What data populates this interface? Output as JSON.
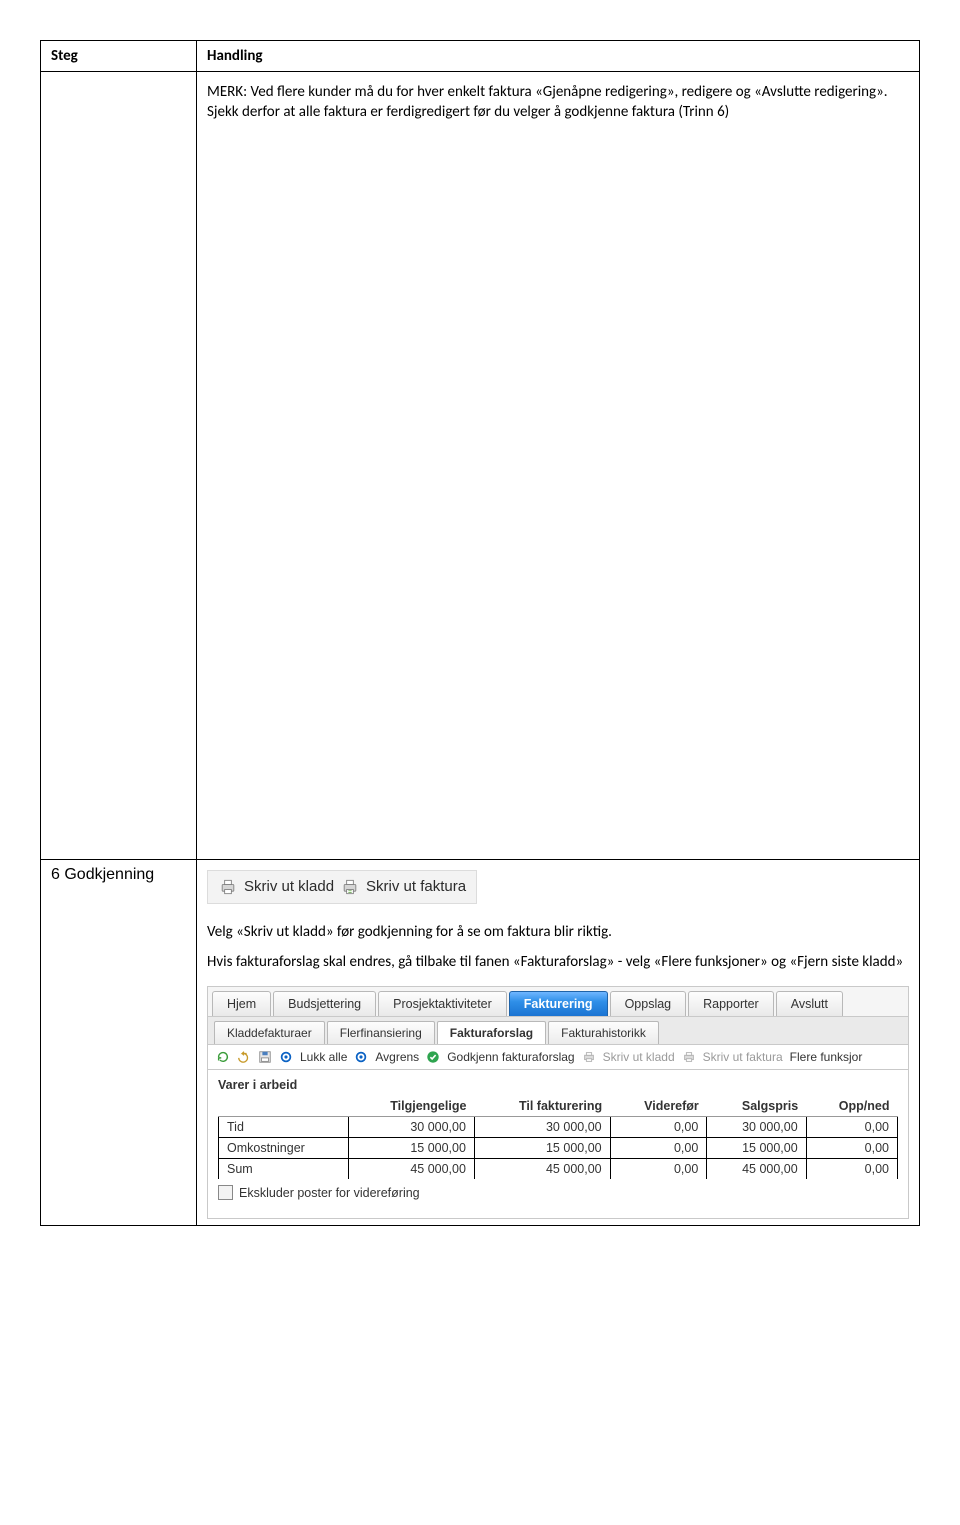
{
  "headers": {
    "steg": "Steg",
    "handling": "Handling"
  },
  "row1": {
    "p1a": "MERK: Ved flere kunder må du for hver enkelt faktura «Gjenåpne redigering», redigere og «Avslutte redigering». Sjekk derfor at alle faktura er ferdigredigert før du velger å godkjenne faktura (Trinn 6)"
  },
  "row2": {
    "step_label": "6 Godkjenning",
    "print": {
      "kladd": "Skriv ut kladd",
      "faktura": "Skriv ut faktura"
    },
    "p1": "Velg «Skriv ut kladd» før godkjenning for å se om faktura blir riktig.",
    "p2": "Hvis fakturaforslag skal endres, gå tilbake til fanen «Fakturaforslag» - velg «Flere funksjoner» og «Fjern siste kladd»",
    "tabs1": [
      "Hjem",
      "Budsjettering",
      "Prosjektaktiviteter",
      "Fakturering",
      "Oppslag",
      "Rapporter",
      "Avslutt"
    ],
    "tabs1_active_index": 3,
    "tabs2": [
      "Kladdefakturaer",
      "Flerfinansiering",
      "Fakturaforslag",
      "Fakturahistorikk"
    ],
    "tabs2_active_index": 2,
    "toolbar": {
      "lukk_alle": "Lukk alle",
      "avgrens": "Avgrens",
      "godkjenn": "Godkjenn fakturaforslag",
      "skriv_kladd": "Skriv ut kladd",
      "skriv_faktura": "Skriv ut faktura",
      "flere": "Flere funksjor"
    },
    "varer": {
      "title": "Varer i arbeid",
      "cols": [
        "",
        "Tilgjengelige",
        "Til fakturering",
        "Viderefør",
        "Salgspris",
        "Opp/ned"
      ],
      "rows": [
        {
          "label": "Tid",
          "tilgj": "30 000,00",
          "tilfakt": "30 000,00",
          "videre": "0,00",
          "salgspris": "30 000,00",
          "oppned": "0,00"
        },
        {
          "label": "Omkostninger",
          "tilgj": "15 000,00",
          "tilfakt": "15 000,00",
          "videre": "0,00",
          "salgspris": "15 000,00",
          "oppned": "0,00"
        },
        {
          "label": "Sum",
          "tilgj": "45 000,00",
          "tilfakt": "45 000,00",
          "videre": "0,00",
          "salgspris": "45 000,00",
          "oppned": "0,00"
        }
      ],
      "exclude_label": "Ekskluder poster for videreføring"
    }
  }
}
